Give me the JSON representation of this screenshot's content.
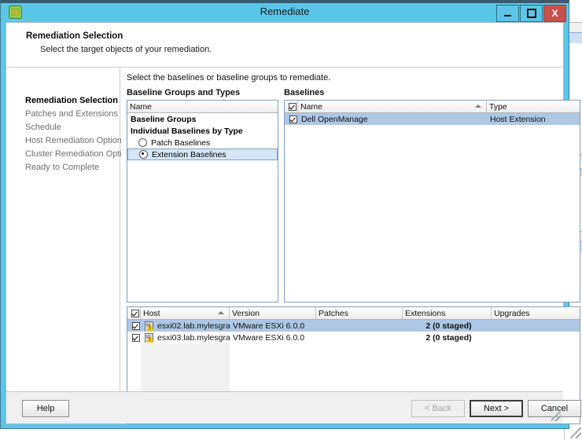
{
  "window": {
    "title": "Remediate",
    "icon": "vmware-update-manager-icon",
    "minimize_label": "Minimize",
    "maximize_label": "Maximize",
    "close_label": "X"
  },
  "header": {
    "title": "Remediation Selection",
    "subtitle": "Select the target objects of your remediation."
  },
  "nav": {
    "items": [
      {
        "label": "Remediation Selection",
        "active": true
      },
      {
        "label": "Patches and Extensions",
        "active": false
      },
      {
        "label": "Schedule",
        "active": false
      },
      {
        "label": "Host Remediation Options",
        "active": false
      },
      {
        "label": "Cluster Remediation Options",
        "active": false
      },
      {
        "label": "Ready to Complete",
        "active": false
      }
    ]
  },
  "main": {
    "instruction": "Select the baselines or baseline groups to remediate.",
    "baseline_types": {
      "label": "Baseline Groups and Types",
      "column_header": "Name",
      "rows": [
        {
          "label": "Baseline Groups",
          "style": "bold",
          "selected": false
        },
        {
          "label": "Individual Baselines by Type",
          "style": "bold",
          "selected": false
        },
        {
          "label": "Patch Baselines",
          "style": "radio",
          "radio_on": false,
          "selected": false
        },
        {
          "label": "Extension Baselines",
          "style": "radio",
          "radio_on": true,
          "selected": true
        }
      ]
    },
    "baselines": {
      "label": "Baselines",
      "select_all_checked": true,
      "columns": [
        {
          "label": "Name",
          "sorted": true
        },
        {
          "label": "Type",
          "sorted": false
        }
      ],
      "rows": [
        {
          "checked": true,
          "name": "Dell OpenManage",
          "type": "Host Extension",
          "selected": true
        }
      ]
    },
    "hosts": {
      "select_all_checked": true,
      "columns": [
        {
          "label": "Host",
          "sorted": true
        },
        {
          "label": "Version",
          "sorted": false
        },
        {
          "label": "Patches",
          "sorted": false
        },
        {
          "label": "Extensions",
          "sorted": false
        },
        {
          "label": "Upgrades",
          "sorted": false
        }
      ],
      "rows": [
        {
          "checked": true,
          "host": "esxi02.lab.mylesgra...",
          "version": "VMware ESXi 6.0.0",
          "patches": "",
          "extensions": "2 (0 staged)",
          "upgrades": "",
          "selected": true,
          "icon": "host-warning-icon"
        },
        {
          "checked": true,
          "host": "esxi03.lab.mylesgra...",
          "version": "VMware ESXi 6.0.0",
          "patches": "",
          "extensions": "2 (0 staged)",
          "upgrades": "",
          "selected": false,
          "icon": "host-warning-icon"
        }
      ]
    }
  },
  "buttons": {
    "help": "Help",
    "back": "< Back",
    "next": "Next >",
    "cancel": "Cancel"
  },
  "colors": {
    "titlebar": "#5bc6e8",
    "close_button": "#c9514b",
    "selection": "#aec7e4",
    "tree_selection": "#d6e6f7",
    "warning": "#f2c219"
  }
}
